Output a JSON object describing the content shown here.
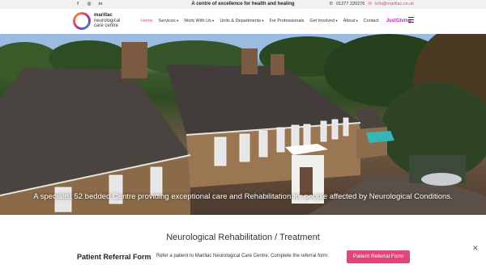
{
  "topbar": {
    "socials": [
      {
        "icon": "facebook-icon",
        "glyph": "f"
      },
      {
        "icon": "instagram-icon",
        "glyph": "◎"
      },
      {
        "icon": "linkedin-icon",
        "glyph": "in"
      }
    ],
    "tagline": "A centre of excellence for health and healing",
    "phone": "01277 220276",
    "email": "info@marillac.co.uk"
  },
  "logo": {
    "line1": "marillac",
    "line2": "neurological",
    "line3": "care centre"
  },
  "nav": {
    "items": [
      {
        "label": "Home",
        "active": true,
        "dropdown": false
      },
      {
        "label": "Services",
        "active": false,
        "dropdown": true
      },
      {
        "label": "Work With Us",
        "active": false,
        "dropdown": true
      },
      {
        "label": "Units & Departments",
        "active": false,
        "dropdown": true
      },
      {
        "label": "For Professionals",
        "active": false,
        "dropdown": false
      },
      {
        "label": "Get Involved",
        "active": false,
        "dropdown": true
      },
      {
        "label": "About",
        "active": false,
        "dropdown": true
      },
      {
        "label": "Contact",
        "active": false,
        "dropdown": false
      }
    ],
    "justgiving": "JustGiving"
  },
  "hero": {
    "caption": "A specialist 52 bedded Centre providing exceptional care and Rehabilitation for people affected by Neurological Conditions."
  },
  "section": {
    "title": "Neurological Rehabilitation / Treatment"
  },
  "referral": {
    "title": "Patient Referral Form",
    "description": "Refer a patient to Marillac Neurological Care Centre. Complete the referral form:",
    "button": "Patient Referral Form",
    "close": "✕"
  },
  "colors": {
    "accent": "#e0457b",
    "justgiving": "#ad29b6"
  }
}
